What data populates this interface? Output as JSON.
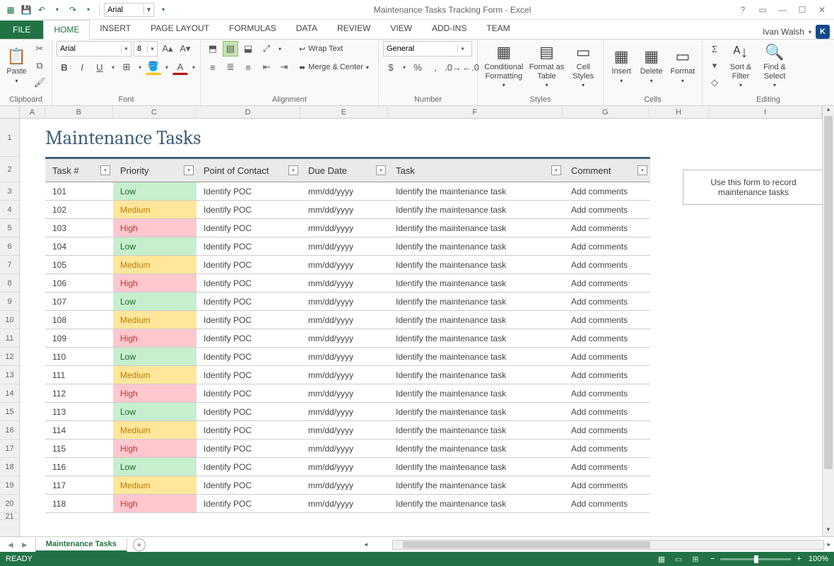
{
  "app": {
    "title": "Maintenance Tasks Tracking Form - Excel",
    "user": "Ivan Walsh",
    "user_initial": "K"
  },
  "qat": {
    "font": "Arial"
  },
  "ribbon": {
    "file": "FILE",
    "tabs": [
      "HOME",
      "INSERT",
      "PAGE LAYOUT",
      "FORMULAS",
      "DATA",
      "REVIEW",
      "VIEW",
      "ADD-INS",
      "TEAM"
    ],
    "active": "HOME",
    "clipboard": {
      "paste": "Paste",
      "label": "Clipboard"
    },
    "font": {
      "name": "Arial",
      "size": "8",
      "label": "Font"
    },
    "alignment": {
      "wrap": "Wrap Text",
      "merge": "Merge & Center",
      "label": "Alignment"
    },
    "number": {
      "format": "General",
      "label": "Number"
    },
    "styles": {
      "cond": "Conditional Formatting",
      "table": "Format as Table",
      "cell": "Cell Styles",
      "label": "Styles"
    },
    "cells": {
      "insert": "Insert",
      "delete": "Delete",
      "format": "Format",
      "label": "Cells"
    },
    "editing": {
      "sort": "Sort & Filter",
      "find": "Find & Select",
      "label": "Editing"
    }
  },
  "columns": {
    "letters": [
      "A",
      "B",
      "C",
      "D",
      "E",
      "F",
      "G",
      "H",
      "I"
    ],
    "widths": [
      36,
      96,
      118,
      148,
      124,
      248,
      122,
      86,
      160
    ]
  },
  "sheet": {
    "title": "Maintenance Tasks",
    "headers": [
      "Task #",
      "Priority",
      "Point of Contact",
      "Due Date",
      "Task",
      "Comment"
    ],
    "infobox": "Use this form to record maintenance tasks",
    "rows": [
      {
        "n": "101",
        "p": "Low",
        "poc": "Identify POC",
        "due": "mm/dd/yyyy",
        "task": "Identify the maintenance task",
        "c": "Add comments"
      },
      {
        "n": "102",
        "p": "Medium",
        "poc": "Identify POC",
        "due": "mm/dd/yyyy",
        "task": "Identify the maintenance task",
        "c": "Add comments"
      },
      {
        "n": "103",
        "p": "High",
        "poc": "Identify POC",
        "due": "mm/dd/yyyy",
        "task": "Identify the maintenance task",
        "c": "Add comments"
      },
      {
        "n": "104",
        "p": "Low",
        "poc": "Identify POC",
        "due": "mm/dd/yyyy",
        "task": "Identify the maintenance task",
        "c": "Add comments"
      },
      {
        "n": "105",
        "p": "Medium",
        "poc": "Identify POC",
        "due": "mm/dd/yyyy",
        "task": "Identify the maintenance task",
        "c": "Add comments"
      },
      {
        "n": "106",
        "p": "High",
        "poc": "Identify POC",
        "due": "mm/dd/yyyy",
        "task": "Identify the maintenance task",
        "c": "Add comments"
      },
      {
        "n": "107",
        "p": "Low",
        "poc": "Identify POC",
        "due": "mm/dd/yyyy",
        "task": "Identify the maintenance task",
        "c": "Add comments"
      },
      {
        "n": "108",
        "p": "Medium",
        "poc": "Identify POC",
        "due": "mm/dd/yyyy",
        "task": "Identify the maintenance task",
        "c": "Add comments"
      },
      {
        "n": "109",
        "p": "High",
        "poc": "Identify POC",
        "due": "mm/dd/yyyy",
        "task": "Identify the maintenance task",
        "c": "Add comments"
      },
      {
        "n": "110",
        "p": "Low",
        "poc": "Identify POC",
        "due": "mm/dd/yyyy",
        "task": "Identify the maintenance task",
        "c": "Add comments"
      },
      {
        "n": "111",
        "p": "Medium",
        "poc": "Identify POC",
        "due": "mm/dd/yyyy",
        "task": "Identify the maintenance task",
        "c": "Add comments"
      },
      {
        "n": "112",
        "p": "High",
        "poc": "Identify POC",
        "due": "mm/dd/yyyy",
        "task": "Identify the maintenance task",
        "c": "Add comments"
      },
      {
        "n": "113",
        "p": "Low",
        "poc": "Identify POC",
        "due": "mm/dd/yyyy",
        "task": "Identify the maintenance task",
        "c": "Add comments"
      },
      {
        "n": "114",
        "p": "Medium",
        "poc": "Identify POC",
        "due": "mm/dd/yyyy",
        "task": "Identify the maintenance task",
        "c": "Add comments"
      },
      {
        "n": "115",
        "p": "High",
        "poc": "Identify POC",
        "due": "mm/dd/yyyy",
        "task": "Identify the maintenance task",
        "c": "Add comments"
      },
      {
        "n": "116",
        "p": "Low",
        "poc": "Identify POC",
        "due": "mm/dd/yyyy",
        "task": "Identify the maintenance task",
        "c": "Add comments"
      },
      {
        "n": "117",
        "p": "Medium",
        "poc": "Identify POC",
        "due": "mm/dd/yyyy",
        "task": "Identify the maintenance task",
        "c": "Add comments"
      },
      {
        "n": "118",
        "p": "High",
        "poc": "Identify POC",
        "due": "mm/dd/yyyy",
        "task": "Identify the maintenance task",
        "c": "Add comments"
      }
    ],
    "tab": "Maintenance Tasks"
  },
  "status": {
    "ready": "READY",
    "zoom": "100%"
  }
}
